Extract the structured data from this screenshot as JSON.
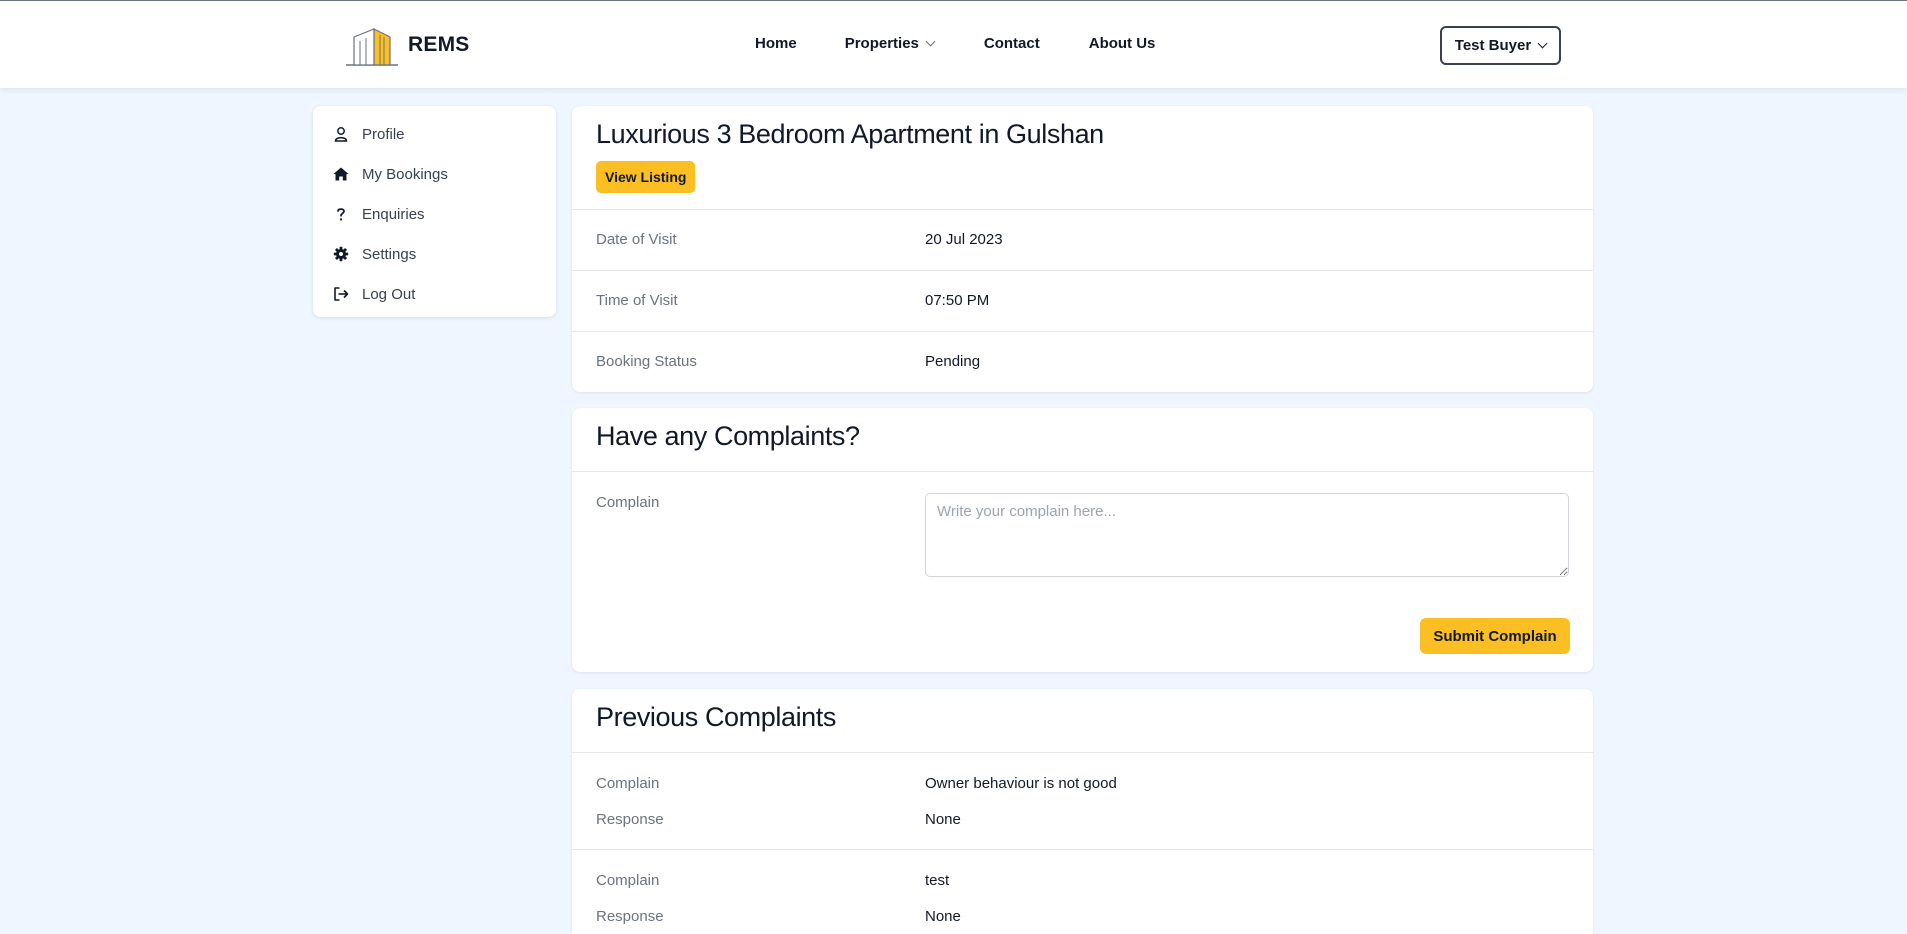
{
  "header": {
    "brand": "REMS",
    "nav": {
      "home": "Home",
      "properties": "Properties",
      "contact": "Contact",
      "about": "About Us"
    },
    "user_menu": "Test Buyer"
  },
  "sidebar": {
    "items": [
      {
        "label": "Profile",
        "icon": "user-icon"
      },
      {
        "label": "My Bookings",
        "icon": "home-icon"
      },
      {
        "label": "Enquiries",
        "icon": "question-icon"
      },
      {
        "label": "Settings",
        "icon": "gear-icon"
      },
      {
        "label": "Log Out",
        "icon": "logout-icon"
      }
    ]
  },
  "booking": {
    "title": "Luxurious 3 Bedroom Apartment in Gulshan",
    "view_listing": "View Listing",
    "rows": [
      {
        "label": "Date of Visit",
        "value": "20 Jul 2023"
      },
      {
        "label": "Time of Visit",
        "value": "07:50 PM"
      },
      {
        "label": "Booking Status",
        "value": "Pending"
      }
    ]
  },
  "complaint_form": {
    "title": "Have any Complaints?",
    "label": "Complain",
    "placeholder": "Write your complain here...",
    "value": "",
    "submit": "Submit Complain"
  },
  "previous_complaints": {
    "title": "Previous Complaints",
    "complain_label": "Complain",
    "response_label": "Response",
    "items": [
      {
        "complain": "Owner behaviour is not good",
        "response": "None"
      },
      {
        "complain": "test",
        "response": "None"
      }
    ]
  },
  "colors": {
    "accent": "#fbbf24",
    "page_bg": "#eff6ff",
    "text": "#111827",
    "muted": "#6b7280"
  }
}
